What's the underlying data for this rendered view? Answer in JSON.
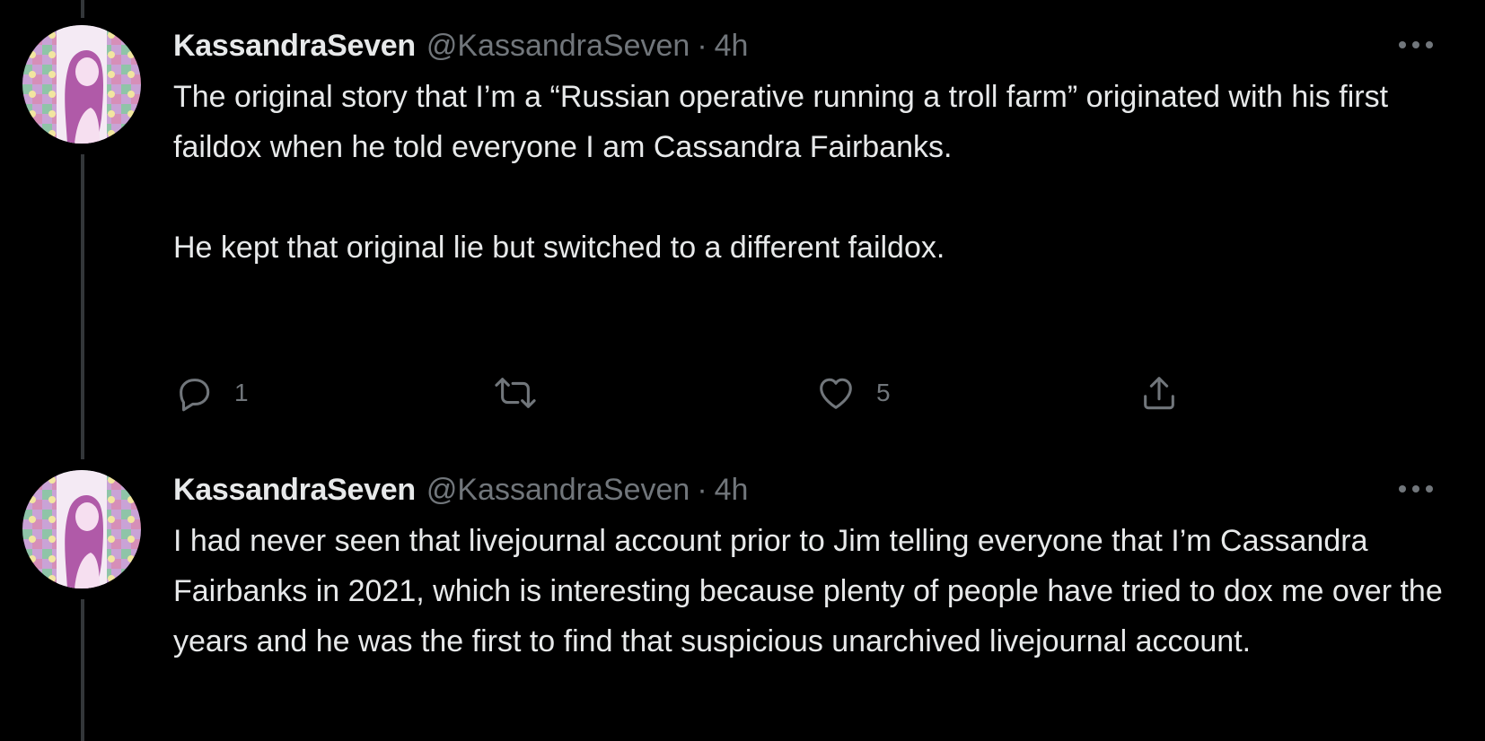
{
  "tweets": [
    {
      "display_name": "KassandraSeven",
      "handle": "@KassandraSeven",
      "separator": "·",
      "time": "4h",
      "text": "The original story that I’m a “Russian operative running a troll farm” originated with his first faildox when he told everyone I am Cassandra Fairbanks.\n\nHe kept that original lie but switched to a different faildox.",
      "reply_count": "1",
      "retweet_count": "",
      "like_count": "5"
    },
    {
      "display_name": "KassandraSeven",
      "handle": "@KassandraSeven",
      "separator": "·",
      "time": "4h",
      "text": "I had never seen that livejournal account prior to Jim telling everyone that I’m Cassandra Fairbanks in 2021, which is interesting because plenty of people have tried to dox me over the years and he was the first to find that suspicious unarchived livejournal account."
    }
  ],
  "icons": {
    "more": "more-horizontal-icon",
    "reply": "reply-bubble-icon",
    "retweet": "retweet-icon",
    "like": "heart-icon",
    "share": "share-icon"
  },
  "colors": {
    "background": "#000000",
    "primary_text": "#e7e9ea",
    "secondary_text": "#71767b",
    "thread_line": "#333639"
  }
}
